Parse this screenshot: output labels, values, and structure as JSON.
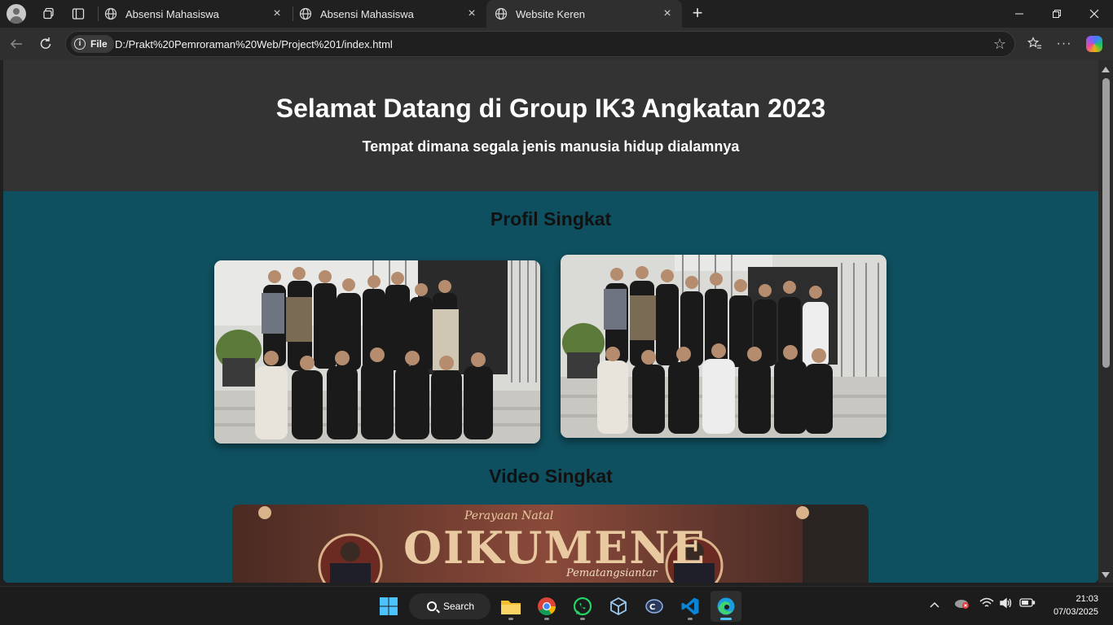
{
  "browser": {
    "tabs": [
      {
        "title": "Absensi Mahasiswa",
        "active": false
      },
      {
        "title": "Absensi Mahasiswa",
        "active": false
      },
      {
        "title": "Website Keren",
        "active": true
      }
    ],
    "address": {
      "scheme_label": "File",
      "url": "D:/Prakt%20Pemroraman%20Web/Project%201/index.html"
    }
  },
  "page": {
    "header": {
      "title": "Selamat Datang di Group IK3 Angkatan 2023",
      "subtitle": "Tempat dimana segala jenis manusia hidup dialamnya"
    },
    "profil": {
      "heading": "Profil Singkat"
    },
    "video": {
      "heading": "Video Singkat",
      "banner_script": "Perayaan Natal",
      "banner_title": "OIKUMENE",
      "banner_sub": "Pematangsiantar"
    }
  },
  "taskbar": {
    "search_label": "Search",
    "time": "21:03",
    "date": "07/03/2025"
  },
  "colors": {
    "page_bg": "#0f5060",
    "header_bg": "#333333",
    "browser_chrome": "#202020",
    "active_tab": "#2f2f2f",
    "accent": "#4cc2ff"
  }
}
